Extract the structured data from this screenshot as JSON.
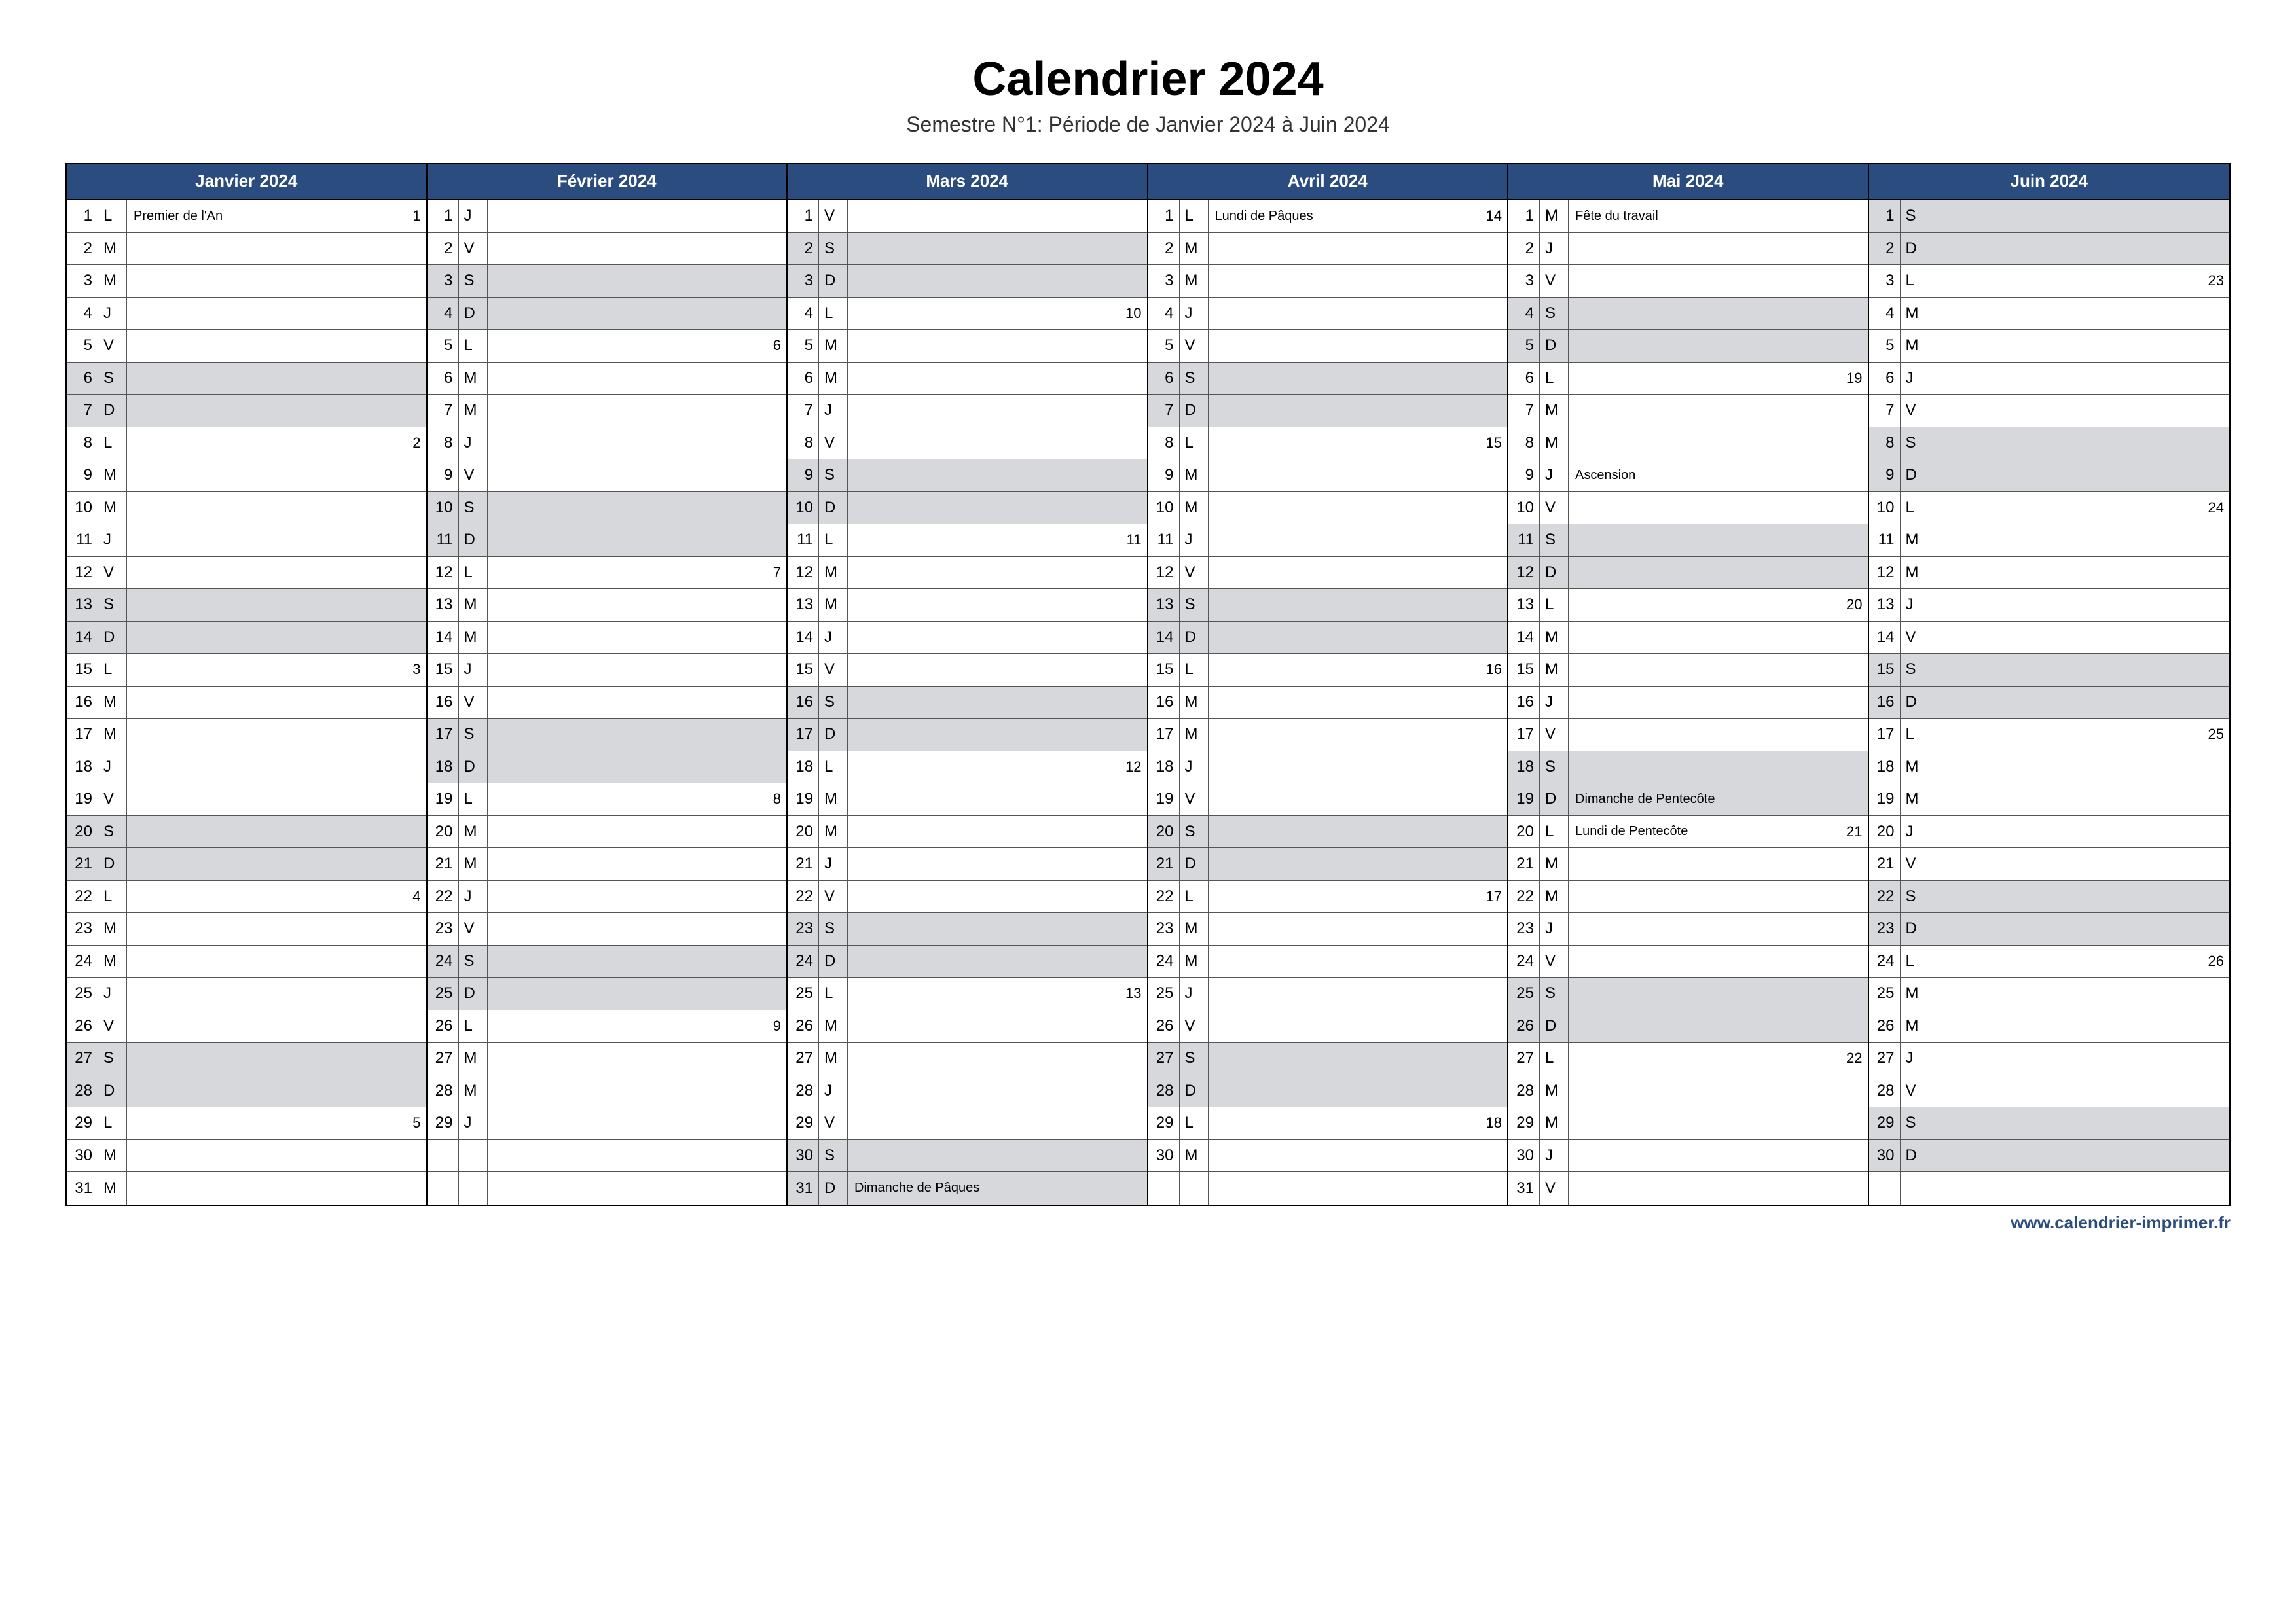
{
  "title": "Calendrier 2024",
  "subtitle": "Semestre N°1: Période de Janvier 2024 à Juin 2024",
  "footer": "www.calendrier-imprimer.fr",
  "colors": {
    "header_bg": "#2b4c7e",
    "weekend_bg": "#d7d8dc"
  },
  "months": [
    {
      "name": "Janvier 2024",
      "days": [
        {
          "n": 1,
          "d": "L",
          "txt": "Premier de l'An",
          "wk": "1"
        },
        {
          "n": 2,
          "d": "M"
        },
        {
          "n": 3,
          "d": "M"
        },
        {
          "n": 4,
          "d": "J"
        },
        {
          "n": 5,
          "d": "V"
        },
        {
          "n": 6,
          "d": "S",
          "we": true
        },
        {
          "n": 7,
          "d": "D",
          "we": true
        },
        {
          "n": 8,
          "d": "L",
          "wk": "2"
        },
        {
          "n": 9,
          "d": "M"
        },
        {
          "n": 10,
          "d": "M"
        },
        {
          "n": 11,
          "d": "J"
        },
        {
          "n": 12,
          "d": "V"
        },
        {
          "n": 13,
          "d": "S",
          "we": true
        },
        {
          "n": 14,
          "d": "D",
          "we": true
        },
        {
          "n": 15,
          "d": "L",
          "wk": "3"
        },
        {
          "n": 16,
          "d": "M"
        },
        {
          "n": 17,
          "d": "M"
        },
        {
          "n": 18,
          "d": "J"
        },
        {
          "n": 19,
          "d": "V"
        },
        {
          "n": 20,
          "d": "S",
          "we": true
        },
        {
          "n": 21,
          "d": "D",
          "we": true
        },
        {
          "n": 22,
          "d": "L",
          "wk": "4"
        },
        {
          "n": 23,
          "d": "M"
        },
        {
          "n": 24,
          "d": "M"
        },
        {
          "n": 25,
          "d": "J"
        },
        {
          "n": 26,
          "d": "V"
        },
        {
          "n": 27,
          "d": "S",
          "we": true
        },
        {
          "n": 28,
          "d": "D",
          "we": true
        },
        {
          "n": 29,
          "d": "L",
          "wk": "5"
        },
        {
          "n": 30,
          "d": "M"
        },
        {
          "n": 31,
          "d": "M"
        }
      ]
    },
    {
      "name": "Février 2024",
      "days": [
        {
          "n": 1,
          "d": "J"
        },
        {
          "n": 2,
          "d": "V"
        },
        {
          "n": 3,
          "d": "S",
          "we": true
        },
        {
          "n": 4,
          "d": "D",
          "we": true
        },
        {
          "n": 5,
          "d": "L",
          "wk": "6"
        },
        {
          "n": 6,
          "d": "M"
        },
        {
          "n": 7,
          "d": "M"
        },
        {
          "n": 8,
          "d": "J"
        },
        {
          "n": 9,
          "d": "V"
        },
        {
          "n": 10,
          "d": "S",
          "we": true
        },
        {
          "n": 11,
          "d": "D",
          "we": true
        },
        {
          "n": 12,
          "d": "L",
          "wk": "7"
        },
        {
          "n": 13,
          "d": "M"
        },
        {
          "n": 14,
          "d": "M"
        },
        {
          "n": 15,
          "d": "J"
        },
        {
          "n": 16,
          "d": "V"
        },
        {
          "n": 17,
          "d": "S",
          "we": true
        },
        {
          "n": 18,
          "d": "D",
          "we": true
        },
        {
          "n": 19,
          "d": "L",
          "wk": "8"
        },
        {
          "n": 20,
          "d": "M"
        },
        {
          "n": 21,
          "d": "M"
        },
        {
          "n": 22,
          "d": "J"
        },
        {
          "n": 23,
          "d": "V"
        },
        {
          "n": 24,
          "d": "S",
          "we": true
        },
        {
          "n": 25,
          "d": "D",
          "we": true
        },
        {
          "n": 26,
          "d": "L",
          "wk": "9"
        },
        {
          "n": 27,
          "d": "M"
        },
        {
          "n": 28,
          "d": "M"
        },
        {
          "n": 29,
          "d": "J"
        },
        {
          "empty": true
        },
        {
          "empty": true
        }
      ]
    },
    {
      "name": "Mars 2024",
      "days": [
        {
          "n": 1,
          "d": "V"
        },
        {
          "n": 2,
          "d": "S",
          "we": true
        },
        {
          "n": 3,
          "d": "D",
          "we": true
        },
        {
          "n": 4,
          "d": "L",
          "wk": "10"
        },
        {
          "n": 5,
          "d": "M"
        },
        {
          "n": 6,
          "d": "M"
        },
        {
          "n": 7,
          "d": "J"
        },
        {
          "n": 8,
          "d": "V"
        },
        {
          "n": 9,
          "d": "S",
          "we": true
        },
        {
          "n": 10,
          "d": "D",
          "we": true
        },
        {
          "n": 11,
          "d": "L",
          "wk": "11"
        },
        {
          "n": 12,
          "d": "M"
        },
        {
          "n": 13,
          "d": "M"
        },
        {
          "n": 14,
          "d": "J"
        },
        {
          "n": 15,
          "d": "V"
        },
        {
          "n": 16,
          "d": "S",
          "we": true
        },
        {
          "n": 17,
          "d": "D",
          "we": true
        },
        {
          "n": 18,
          "d": "L",
          "wk": "12"
        },
        {
          "n": 19,
          "d": "M"
        },
        {
          "n": 20,
          "d": "M"
        },
        {
          "n": 21,
          "d": "J"
        },
        {
          "n": 22,
          "d": "V"
        },
        {
          "n": 23,
          "d": "S",
          "we": true
        },
        {
          "n": 24,
          "d": "D",
          "we": true
        },
        {
          "n": 25,
          "d": "L",
          "wk": "13"
        },
        {
          "n": 26,
          "d": "M"
        },
        {
          "n": 27,
          "d": "M"
        },
        {
          "n": 28,
          "d": "J"
        },
        {
          "n": 29,
          "d": "V"
        },
        {
          "n": 30,
          "d": "S",
          "we": true
        },
        {
          "n": 31,
          "d": "D",
          "we": true,
          "txt": "Dimanche de Pâques"
        }
      ]
    },
    {
      "name": "Avril 2024",
      "days": [
        {
          "n": 1,
          "d": "L",
          "txt": "Lundi de Pâques",
          "wk": "14"
        },
        {
          "n": 2,
          "d": "M"
        },
        {
          "n": 3,
          "d": "M"
        },
        {
          "n": 4,
          "d": "J"
        },
        {
          "n": 5,
          "d": "V"
        },
        {
          "n": 6,
          "d": "S",
          "we": true
        },
        {
          "n": 7,
          "d": "D",
          "we": true
        },
        {
          "n": 8,
          "d": "L",
          "wk": "15"
        },
        {
          "n": 9,
          "d": "M"
        },
        {
          "n": 10,
          "d": "M"
        },
        {
          "n": 11,
          "d": "J"
        },
        {
          "n": 12,
          "d": "V"
        },
        {
          "n": 13,
          "d": "S",
          "we": true
        },
        {
          "n": 14,
          "d": "D",
          "we": true
        },
        {
          "n": 15,
          "d": "L",
          "wk": "16"
        },
        {
          "n": 16,
          "d": "M"
        },
        {
          "n": 17,
          "d": "M"
        },
        {
          "n": 18,
          "d": "J"
        },
        {
          "n": 19,
          "d": "V"
        },
        {
          "n": 20,
          "d": "S",
          "we": true
        },
        {
          "n": 21,
          "d": "D",
          "we": true
        },
        {
          "n": 22,
          "d": "L",
          "wk": "17"
        },
        {
          "n": 23,
          "d": "M"
        },
        {
          "n": 24,
          "d": "M"
        },
        {
          "n": 25,
          "d": "J"
        },
        {
          "n": 26,
          "d": "V"
        },
        {
          "n": 27,
          "d": "S",
          "we": true
        },
        {
          "n": 28,
          "d": "D",
          "we": true
        },
        {
          "n": 29,
          "d": "L",
          "wk": "18"
        },
        {
          "n": 30,
          "d": "M"
        },
        {
          "empty": true
        }
      ]
    },
    {
      "name": "Mai 2024",
      "days": [
        {
          "n": 1,
          "d": "M",
          "txt": "Fête du travail"
        },
        {
          "n": 2,
          "d": "J"
        },
        {
          "n": 3,
          "d": "V"
        },
        {
          "n": 4,
          "d": "S",
          "we": true
        },
        {
          "n": 5,
          "d": "D",
          "we": true
        },
        {
          "n": 6,
          "d": "L",
          "wk": "19"
        },
        {
          "n": 7,
          "d": "M"
        },
        {
          "n": 8,
          "d": "M"
        },
        {
          "n": 9,
          "d": "J",
          "txt": "Ascension"
        },
        {
          "n": 10,
          "d": "V"
        },
        {
          "n": 11,
          "d": "S",
          "we": true
        },
        {
          "n": 12,
          "d": "D",
          "we": true
        },
        {
          "n": 13,
          "d": "L",
          "wk": "20"
        },
        {
          "n": 14,
          "d": "M"
        },
        {
          "n": 15,
          "d": "M"
        },
        {
          "n": 16,
          "d": "J"
        },
        {
          "n": 17,
          "d": "V"
        },
        {
          "n": 18,
          "d": "S",
          "we": true
        },
        {
          "n": 19,
          "d": "D",
          "we": true,
          "txt": "Dimanche de Pentecôte"
        },
        {
          "n": 20,
          "d": "L",
          "txt": "Lundi de Pentecôte",
          "wk": "21"
        },
        {
          "n": 21,
          "d": "M"
        },
        {
          "n": 22,
          "d": "M"
        },
        {
          "n": 23,
          "d": "J"
        },
        {
          "n": 24,
          "d": "V"
        },
        {
          "n": 25,
          "d": "S",
          "we": true
        },
        {
          "n": 26,
          "d": "D",
          "we": true
        },
        {
          "n": 27,
          "d": "L",
          "wk": "22"
        },
        {
          "n": 28,
          "d": "M"
        },
        {
          "n": 29,
          "d": "M"
        },
        {
          "n": 30,
          "d": "J"
        },
        {
          "n": 31,
          "d": "V"
        }
      ]
    },
    {
      "name": "Juin 2024",
      "days": [
        {
          "n": 1,
          "d": "S",
          "we": true
        },
        {
          "n": 2,
          "d": "D",
          "we": true
        },
        {
          "n": 3,
          "d": "L",
          "wk": "23"
        },
        {
          "n": 4,
          "d": "M"
        },
        {
          "n": 5,
          "d": "M"
        },
        {
          "n": 6,
          "d": "J"
        },
        {
          "n": 7,
          "d": "V"
        },
        {
          "n": 8,
          "d": "S",
          "we": true
        },
        {
          "n": 9,
          "d": "D",
          "we": true
        },
        {
          "n": 10,
          "d": "L",
          "wk": "24"
        },
        {
          "n": 11,
          "d": "M"
        },
        {
          "n": 12,
          "d": "M"
        },
        {
          "n": 13,
          "d": "J"
        },
        {
          "n": 14,
          "d": "V"
        },
        {
          "n": 15,
          "d": "S",
          "we": true
        },
        {
          "n": 16,
          "d": "D",
          "we": true
        },
        {
          "n": 17,
          "d": "L",
          "wk": "25"
        },
        {
          "n": 18,
          "d": "M"
        },
        {
          "n": 19,
          "d": "M"
        },
        {
          "n": 20,
          "d": "J"
        },
        {
          "n": 21,
          "d": "V"
        },
        {
          "n": 22,
          "d": "S",
          "we": true
        },
        {
          "n": 23,
          "d": "D",
          "we": true
        },
        {
          "n": 24,
          "d": "L",
          "wk": "26"
        },
        {
          "n": 25,
          "d": "M"
        },
        {
          "n": 26,
          "d": "M"
        },
        {
          "n": 27,
          "d": "J"
        },
        {
          "n": 28,
          "d": "V"
        },
        {
          "n": 29,
          "d": "S",
          "we": true
        },
        {
          "n": 30,
          "d": "D",
          "we": true
        },
        {
          "empty": true
        }
      ]
    }
  ]
}
